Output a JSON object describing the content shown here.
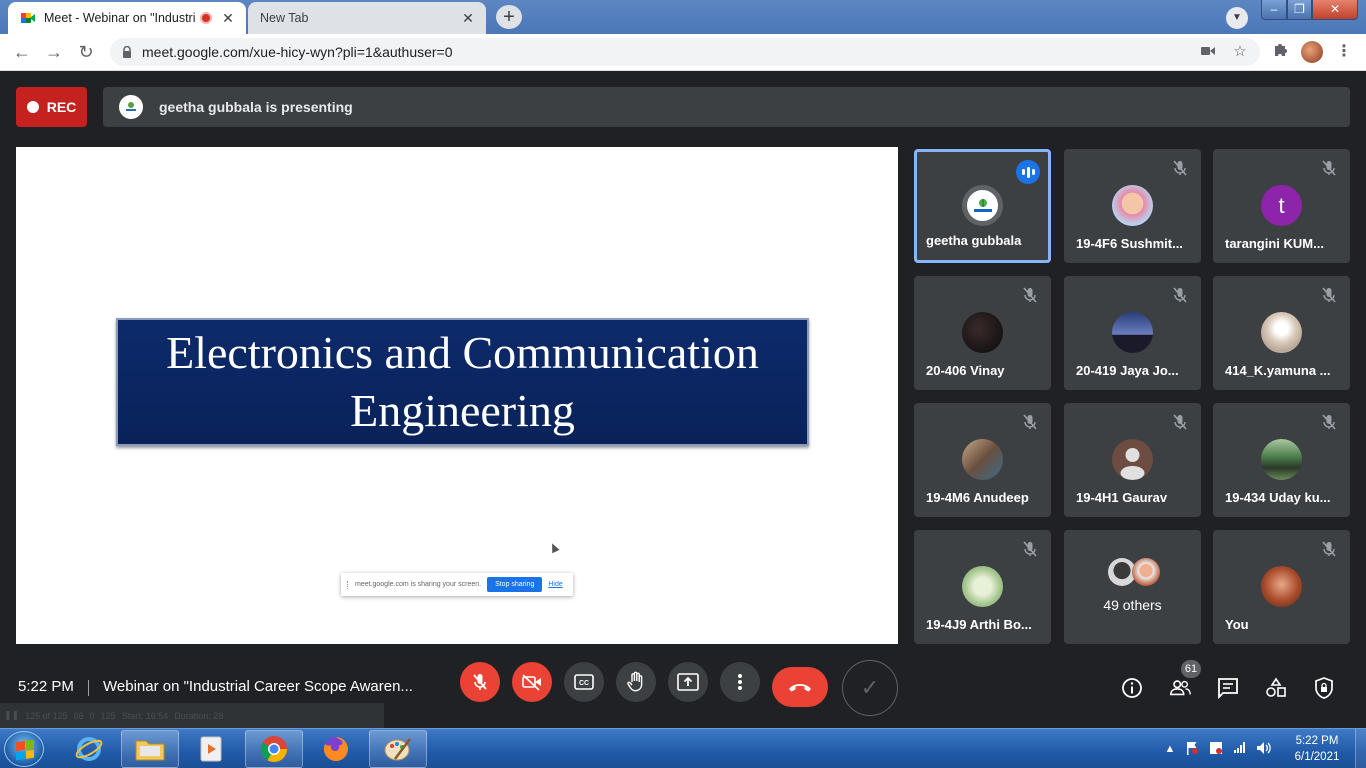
{
  "browser": {
    "tabs": [
      {
        "title": "Meet - Webinar on \"Industri",
        "active": true
      },
      {
        "title": "New Tab",
        "active": false
      }
    ],
    "url": "meet.google.com/xue-hicy-wyn?pli=1&authuser=0"
  },
  "meet": {
    "rec_label": "REC",
    "presenting_text": "geetha gubbala is presenting",
    "slide": {
      "title_line1": "Electronics and Communication",
      "title_line2": "Engineering"
    },
    "share_notice": {
      "text": "meet.google.com is sharing your screen.",
      "stop_label": "Stop sharing",
      "hide_label": "Hide"
    },
    "participants": [
      {
        "name": "geetha gubbala",
        "avatar": "logo",
        "speaking": true
      },
      {
        "name": "19-4F6 Sushmit...",
        "avatar": "photo-baby",
        "muted": true
      },
      {
        "name": "tarangini KUM...",
        "avatar": "letter",
        "letter": "t",
        "color": "#8e24aa",
        "muted": true
      },
      {
        "name": "20-406 Vinay",
        "avatar": "photo-dark",
        "muted": true
      },
      {
        "name": "20-419 Jaya Jo...",
        "avatar": "photo-sky",
        "muted": true
      },
      {
        "name": "414_K.yamuna ...",
        "avatar": "photo-dandelion",
        "muted": true
      },
      {
        "name": "19-4M6 Anudeep",
        "avatar": "photo-anudeep",
        "muted": true
      },
      {
        "name": "19-4H1 Gaurav",
        "avatar": "default-person",
        "muted": true
      },
      {
        "name": "19-434 Uday ku...",
        "avatar": "photo-uday",
        "muted": true
      },
      {
        "name": "19-4J9 Arthi Bo...",
        "avatar": "photo-text",
        "muted": true
      },
      {
        "name": "49 others",
        "avatar": "group"
      },
      {
        "name": "You",
        "avatar": "photo-you",
        "muted": true
      }
    ],
    "time": "5:22 PM",
    "meeting_title": "Webinar on \"Industrial Career Scope Awaren...",
    "people_count": "61",
    "meetext": {
      "stat1": "125 of 125",
      "stat2": "66",
      "stat3": "0",
      "stat4": "125",
      "start": "Start: 16:54",
      "duration": "Duration: 28"
    }
  },
  "taskbar": {
    "time": "5:22 PM",
    "date": "6/1/2021"
  },
  "colors": {
    "rec_red": "#c5221f",
    "meet_red": "#ea4335",
    "meet_bg": "#202124",
    "tile_bg": "#3c4043",
    "speaker_border": "#8ab4f8",
    "slide_navy": "#0c2a6b"
  }
}
